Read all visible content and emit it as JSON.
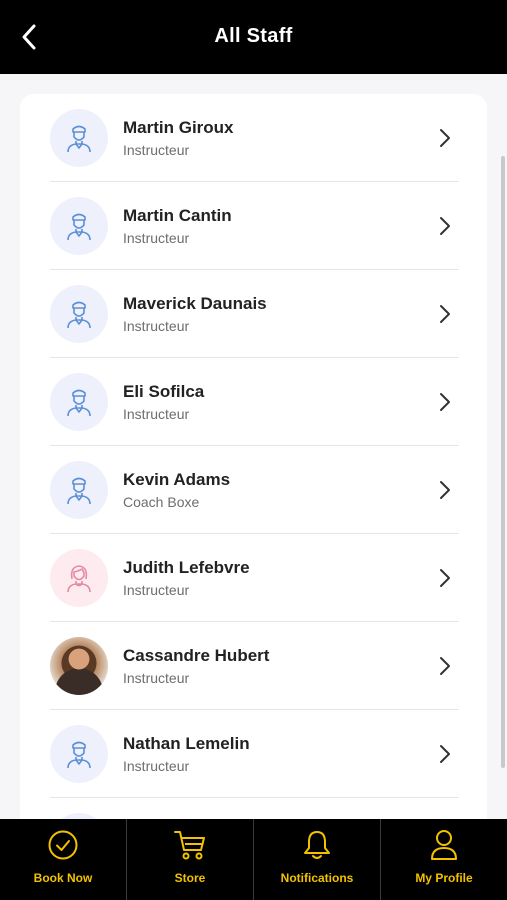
{
  "header": {
    "title": "All Staff",
    "back_icon": "chevron-left-icon"
  },
  "colors": {
    "accent": "#f2c200",
    "header_bg": "#000000",
    "icon_blue": "#5b8fd6",
    "icon_pink": "#e68aa3"
  },
  "staff": [
    {
      "name": "Martin Giroux",
      "role": "Instructeur",
      "avatar": "male-staff-icon"
    },
    {
      "name": "Martin Cantin",
      "role": "Instructeur",
      "avatar": "male-staff-icon"
    },
    {
      "name": "Maverick Daunais",
      "role": "Instructeur",
      "avatar": "male-staff-icon"
    },
    {
      "name": "Eli Sofilca",
      "role": "Instructeur",
      "avatar": "male-staff-icon"
    },
    {
      "name": "Kevin Adams",
      "role": "Coach Boxe",
      "avatar": "male-staff-icon"
    },
    {
      "name": "Judith Lefebvre",
      "role": "Instructeur",
      "avatar": "female-staff-icon"
    },
    {
      "name": "Cassandre Hubert",
      "role": "Instructeur",
      "avatar": "photo"
    },
    {
      "name": "Nathan Lemelin",
      "role": "Instructeur",
      "avatar": "male-staff-icon"
    }
  ],
  "tabs": [
    {
      "label": "Book Now",
      "icon": "check-circle-icon"
    },
    {
      "label": "Store",
      "icon": "cart-icon"
    },
    {
      "label": "Notifications",
      "icon": "bell-icon"
    },
    {
      "label": "My Profile",
      "icon": "user-icon"
    }
  ]
}
